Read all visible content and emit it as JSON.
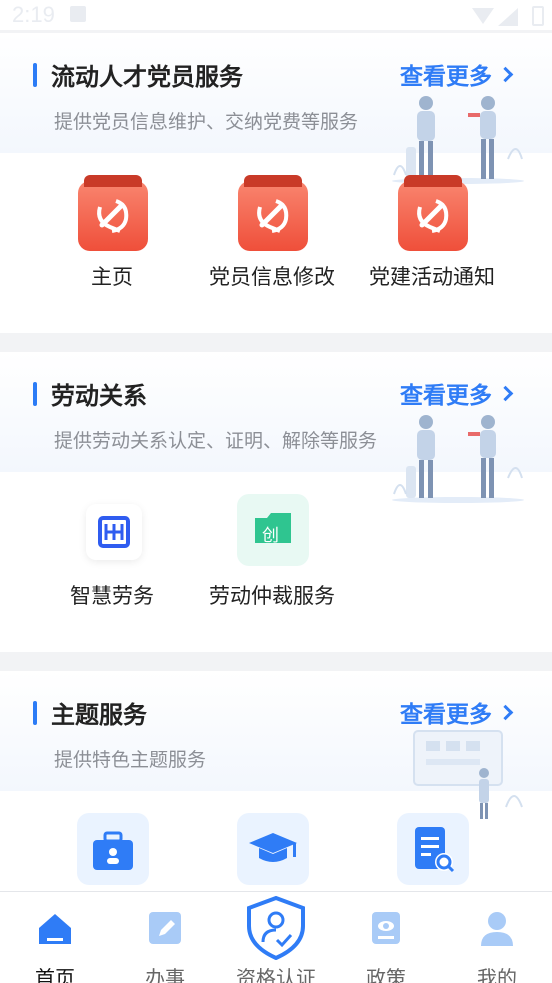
{
  "status_bar": {
    "time": "2:19"
  },
  "sections": [
    {
      "title": "流动人才党员服务",
      "more": "查看更多",
      "subtitle": "提供党员信息维护、交纳党费等服务",
      "items": [
        {
          "label": "主页",
          "icon": "party-emblem-icon"
        },
        {
          "label": "党员信息修改",
          "icon": "party-emblem-icon"
        },
        {
          "label": "党建活动通知",
          "icon": "party-emblem-icon"
        }
      ]
    },
    {
      "title": "劳动关系",
      "more": "查看更多",
      "subtitle": "提供劳动关系认定、证明、解除等服务",
      "items": [
        {
          "label": "智慧劳务",
          "icon": "smart-labor-icon"
        },
        {
          "label": "劳动仲裁服务",
          "icon": "arbitration-icon",
          "badge": "创"
        }
      ]
    },
    {
      "title": "主题服务",
      "more": "查看更多",
      "subtitle": "提供特色主题服务",
      "items": [
        {
          "label": "",
          "icon": "briefcase-icon"
        },
        {
          "label": "",
          "icon": "graduation-cap-icon"
        },
        {
          "label": "",
          "icon": "document-search-icon"
        }
      ]
    }
  ],
  "bottom_nav": [
    {
      "label": "首页",
      "icon": "home-icon",
      "active": true
    },
    {
      "label": "办事",
      "icon": "edit-icon",
      "active": false
    },
    {
      "label": "资格认证",
      "icon": "shield-user-icon",
      "active": false
    },
    {
      "label": "政策",
      "icon": "policy-book-icon",
      "active": false
    },
    {
      "label": "我的",
      "icon": "user-icon",
      "active": false
    }
  ],
  "colors": {
    "accent": "#2f7cf6",
    "party_red": "#ef4f3a",
    "green": "#2fc590"
  }
}
